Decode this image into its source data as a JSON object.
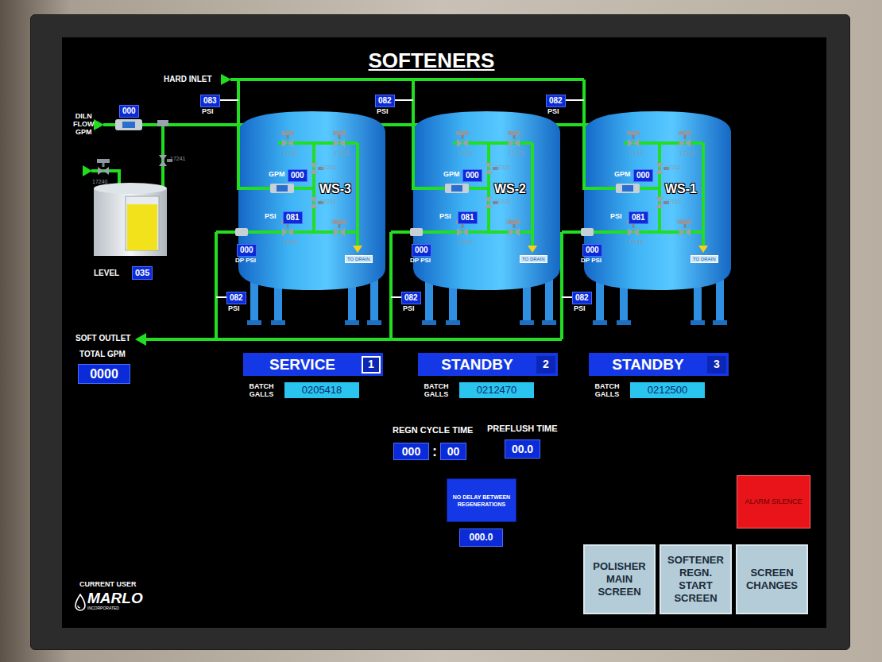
{
  "title": "SOFTENERS",
  "hard_inlet": {
    "label": "HARD INLET"
  },
  "dilution": {
    "lines": [
      "DILN",
      "FLOW",
      "GPM"
    ],
    "value": "000"
  },
  "brine_valves": [
    "17241",
    "17240"
  ],
  "brine_tank": {
    "label": "LEVEL",
    "value": "035",
    "level": 0.85
  },
  "softeners": [
    {
      "name": "WS-3",
      "inlet_psi": "083",
      "inlet_psi_unit": "PSI",
      "flow_label": "GPM",
      "flow": "000",
      "psi_label": "PSI",
      "psi": "081",
      "dp": "000",
      "dp_label": "DP PSI",
      "valves": [
        "17236",
        "17235",
        "17231",
        "17232",
        "17234",
        "17233"
      ],
      "drain": "TO DRAIN",
      "outlet_psi": "082",
      "outlet_psi_unit": "PSI",
      "status": "SERVICE",
      "number": "1",
      "selected": true,
      "batch_label": "BATCH GALLS",
      "batch": "0205418"
    },
    {
      "name": "WS-2",
      "inlet_psi": "082",
      "inlet_psi_unit": "PSI",
      "flow_label": "GPM",
      "flow": "000",
      "psi_label": "PSI",
      "psi": "081",
      "dp": "000",
      "dp_label": "DP PSI",
      "valves": [
        "17226",
        "17225",
        "17221",
        "17222",
        "17224",
        "17223"
      ],
      "drain": "TO DRAIN",
      "outlet_psi": "082",
      "outlet_psi_unit": "PSI",
      "status": "STANDBY",
      "number": "2",
      "selected": false,
      "batch_label": "BATCH GALLS",
      "batch": "0212470"
    },
    {
      "name": "WS-1",
      "inlet_psi": "082",
      "inlet_psi_unit": "PSI",
      "flow_label": "GPM",
      "flow": "000",
      "psi_label": "PSI",
      "psi": "081",
      "dp": "000",
      "dp_label": "DP PSI",
      "valves": [
        "17216",
        "17215",
        "17211",
        "17212",
        "17214",
        "17213"
      ],
      "drain": "TO DRAIN",
      "outlet_psi": "082",
      "outlet_psi_unit": "PSI",
      "status": "STANDBY",
      "number": "3",
      "selected": false,
      "batch_label": "BATCH GALLS",
      "batch": "0212500"
    }
  ],
  "soft_outlet": {
    "label": "SOFT OUTLET",
    "total_label": "TOTAL GPM",
    "total": "0000"
  },
  "regeneration": {
    "cycle_label": "REGN CYCLE TIME",
    "minutes": "000",
    "separator": ":",
    "seconds": "00",
    "preflush_label": "PREFLUSH TIME",
    "preflush": "00.0"
  },
  "delay": {
    "label": "NO DELAY BETWEEN REGENERATIONS",
    "value": "000.0"
  },
  "alarm_silence": "ALARM SILENCE",
  "nav_buttons": [
    "POLISHER MAIN SCREEN",
    "SOFTENER REGN. START SCREEN",
    "SCREEN CHANGES"
  ],
  "current_user": "CURRENT USER",
  "logo": {
    "name": "MARLO",
    "sub": "INCORPORATED"
  }
}
